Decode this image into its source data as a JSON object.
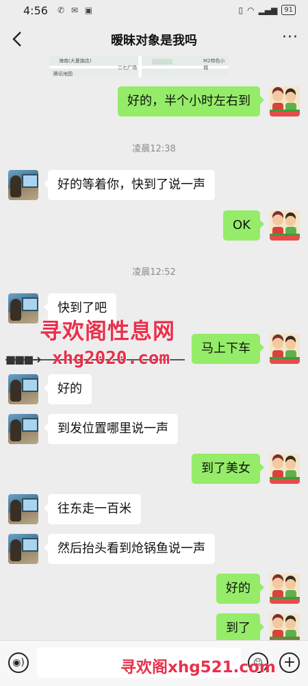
{
  "status_bar": {
    "time": "4:56",
    "battery": "91"
  },
  "header": {
    "title": "暧昧对象是我吗",
    "more": "···",
    "back": "<"
  },
  "map": {
    "labels": [
      "海南(大夏旗店)",
      "二七广场",
      "M2特色小城",
      "腾讯地图"
    ]
  },
  "messages": [
    {
      "side": "right",
      "text": "好的，半个小时左右到"
    },
    {
      "type": "time",
      "text": "凌晨12:38"
    },
    {
      "side": "left",
      "text": "好的等着你，快到了说一声"
    },
    {
      "side": "right",
      "text": "OK"
    },
    {
      "type": "time",
      "text": "凌晨12:52"
    },
    {
      "side": "left",
      "text": "快到了吧"
    },
    {
      "side": "right",
      "text": "马上下车"
    },
    {
      "side": "left",
      "text": "好的"
    },
    {
      "side": "left",
      "text": "到发位置哪里说一声"
    },
    {
      "side": "right",
      "text": "到了美女"
    },
    {
      "side": "left",
      "text": "往东走一百米"
    },
    {
      "side": "left",
      "text": "然后抬头看到炝锅鱼说一声"
    },
    {
      "side": "right",
      "text": "好的"
    },
    {
      "side": "right",
      "text": "到了"
    }
  ],
  "watermark": {
    "line1": "寻欢阁性息网",
    "line2": "xhg2020.com",
    "line3": "寻欢阁xhg521.com"
  },
  "input": {
    "placeholder": ""
  },
  "colors": {
    "sent_bubble": "#95ec69",
    "received_bubble": "#ffffff",
    "background": "#ededed",
    "watermark": "#e8314c"
  }
}
